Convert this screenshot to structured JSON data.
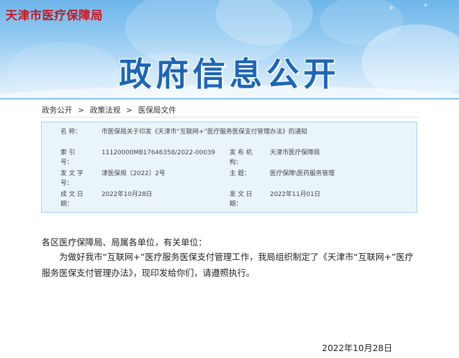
{
  "site": {
    "logo": "天津市医疗保障局",
    "banner_title": "政府信息公开"
  },
  "breadcrumb": {
    "items": [
      "政务公开",
      "政策法规",
      "医保局文件"
    ],
    "separator": ">"
  },
  "info": {
    "name_label": "名      称：",
    "name_value": "市医保局关于印发《天津市“互联网+”医疗服务医保支付管理办法》的通知",
    "index_label": "索      引 号：",
    "index_value": "11120000MB17646358/2022-00039",
    "issuer_label": "发 布 机 构：",
    "issuer_value": "天津市医疗保障局",
    "docno_label": "发 文 字 号：",
    "docno_value": "津医保规〔2022〕2号",
    "topic_label": "主      题：",
    "topic_value": "医疗保障\\医药服务管理",
    "created_label": "成 文 日 期：",
    "created_value": "2022年10月28日",
    "published_label": "发 文 日 期：",
    "published_value": "2022年11月01日"
  },
  "body": {
    "salutation": "各区医疗保障局、局属各单位，有关单位：",
    "paragraph": "为做好我市“互联网+”医疗服务医保支付管理工作，我局组织制定了《天津市“互联网+”医疗服务医保支付管理办法》，现印发给你们，请遵照执行。",
    "date": "2022年10月28日"
  },
  "colors": {
    "logo": "#c8181e",
    "banner_title": "#1c66b7",
    "info_bg": "#eaf4fb",
    "info_border": "#a9d0ec"
  }
}
